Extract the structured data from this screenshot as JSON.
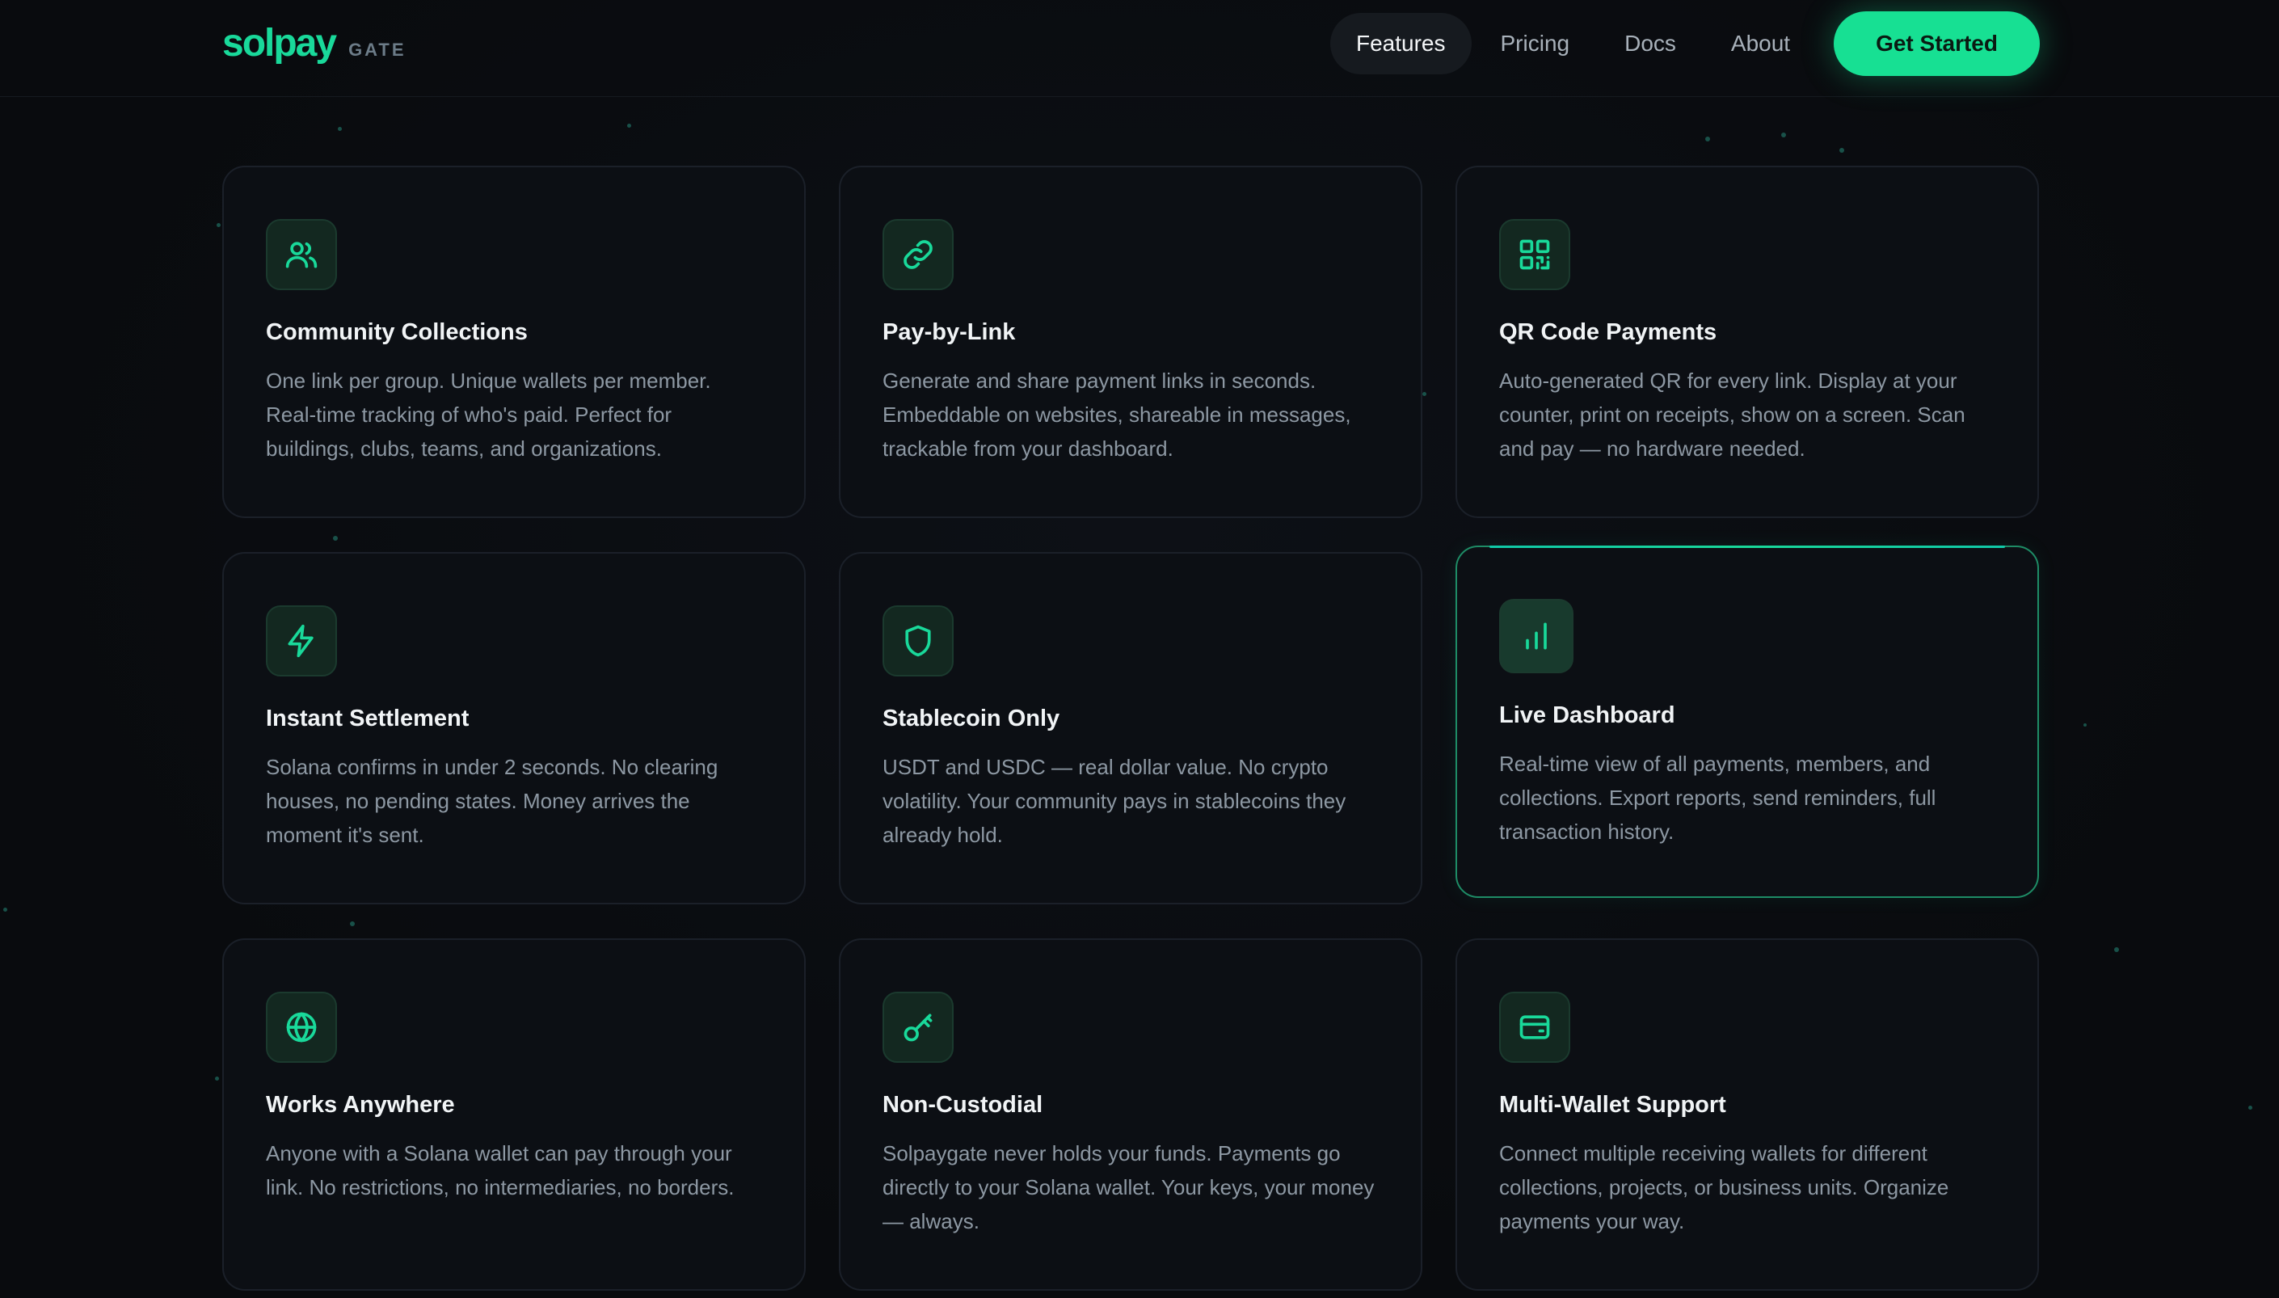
{
  "header": {
    "logo_main": "solpay",
    "logo_sub": "GATE",
    "nav": [
      {
        "label": "Features"
      },
      {
        "label": "Pricing"
      },
      {
        "label": "Docs"
      },
      {
        "label": "About"
      }
    ],
    "cta_label": "Get Started"
  },
  "colors": {
    "accent": "#19d99a",
    "background": "#0a0c10",
    "card_border": "#1b2029",
    "cta": "#17e093"
  },
  "features": [
    {
      "icon": "users-icon",
      "title": "Community Collections",
      "description": "One link per group. Unique wallets per member. Real-time tracking of who's paid. Perfect for buildings, clubs, teams, and organizations."
    },
    {
      "icon": "link-icon",
      "title": "Pay-by-Link",
      "description": "Generate and share payment links in seconds. Embeddable on websites, shareable in messages, trackable from your dashboard."
    },
    {
      "icon": "qr-code-icon",
      "title": "QR Code Payments",
      "description": "Auto-generated QR for every link. Display at your counter, print on receipts, show on a screen. Scan and pay — no hardware needed."
    },
    {
      "icon": "lightning-icon",
      "title": "Instant Settlement",
      "description": "Solana confirms in under 2 seconds. No clearing houses, no pending states. Money arrives the moment it's sent."
    },
    {
      "icon": "shield-icon",
      "title": "Stablecoin Only",
      "description": "USDT and USDC — real dollar value. No crypto volatility. Your community pays in stablecoins they already hold."
    },
    {
      "icon": "bar-chart-icon",
      "title": "Live Dashboard",
      "description": "Real-time view of all payments, members, and collections. Export reports, send reminders, full transaction history."
    },
    {
      "icon": "globe-icon",
      "title": "Works Anywhere",
      "description": "Anyone with a Solana wallet can pay through your link. No restrictions, no intermediaries, no borders."
    },
    {
      "icon": "key-icon",
      "title": "Non-Custodial",
      "description": "Solpaygate never holds your funds. Payments go directly to your Solana wallet. Your keys, your money — always."
    },
    {
      "icon": "wallet-icon",
      "title": "Multi-Wallet Support",
      "description": "Connect multiple receiving wallets for different collections, projects, or business units. Organize payments your way."
    }
  ]
}
